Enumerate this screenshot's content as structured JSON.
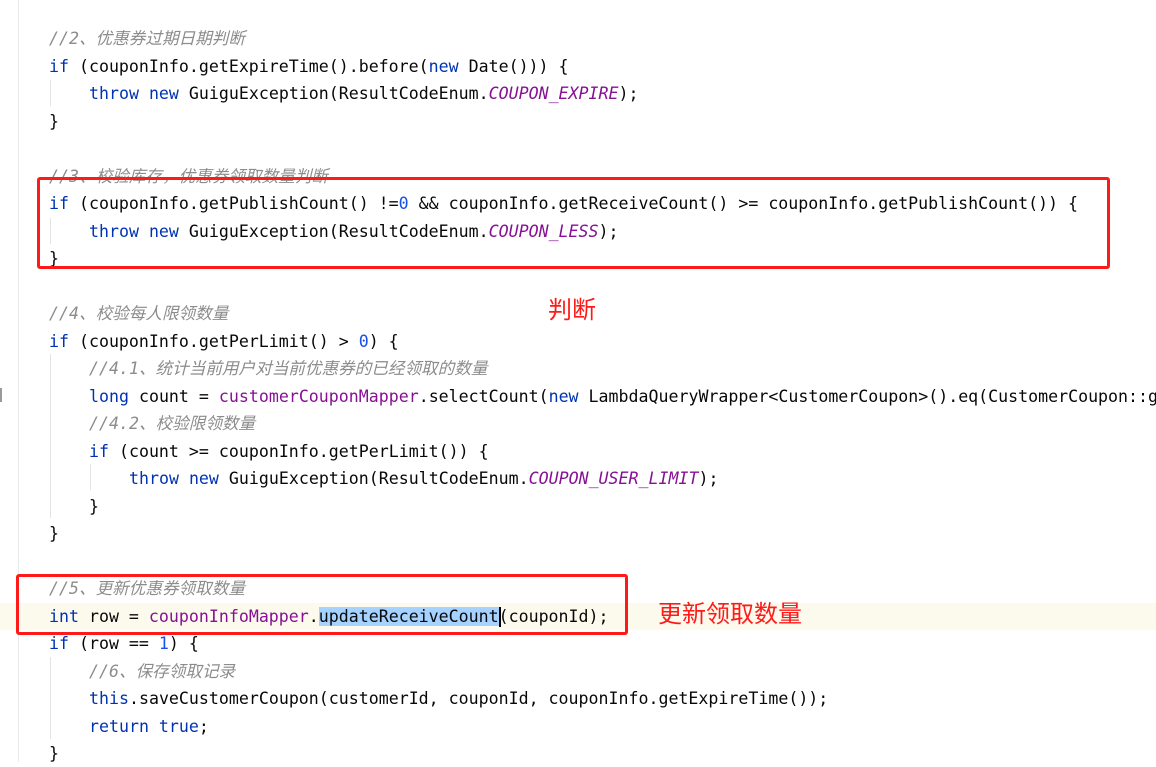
{
  "editor": {
    "caret_line": 21,
    "colors": {
      "keyword": "#0033b3",
      "field": "#871094",
      "comment": "#8c8c8c",
      "number": "#1750eb",
      "text": "#080808",
      "selection": "#a6d2ff",
      "annotation": "#ff1a1a"
    },
    "lines": [
      {
        "indent": 0,
        "tokens": [
          {
            "t": "c",
            "s": "//2、优惠券过期日期判断"
          }
        ]
      },
      {
        "indent": 0,
        "tokens": [
          {
            "t": "k",
            "s": "if"
          },
          {
            "t": "p",
            "s": " (couponInfo.getExpireTime().before("
          },
          {
            "t": "k",
            "s": "new"
          },
          {
            "t": "p",
            "s": " Date())) {"
          }
        ]
      },
      {
        "indent": 1,
        "tokens": [
          {
            "t": "k",
            "s": "throw new"
          },
          {
            "t": "p",
            "s": " GuiguException(ResultCodeEnum."
          },
          {
            "t": "fi",
            "s": "COUPON_EXPIRE"
          },
          {
            "t": "p",
            "s": ");"
          }
        ]
      },
      {
        "indent": 0,
        "tokens": [
          {
            "t": "p",
            "s": "}"
          }
        ]
      },
      {
        "indent": 0,
        "tokens": []
      },
      {
        "indent": 0,
        "tokens": [
          {
            "t": "c",
            "s": "//3、校验库存，优惠券领取数量判断"
          }
        ]
      },
      {
        "indent": 0,
        "tokens": [
          {
            "t": "k",
            "s": "if"
          },
          {
            "t": "p",
            "s": " (couponInfo.getPublishCount() !="
          },
          {
            "t": "n",
            "s": "0"
          },
          {
            "t": "p",
            "s": " && couponInfo.getReceiveCount() >= couponInfo.getPublishCount()) {"
          }
        ]
      },
      {
        "indent": 1,
        "tokens": [
          {
            "t": "k",
            "s": "throw new"
          },
          {
            "t": "p",
            "s": " GuiguException(ResultCodeEnum."
          },
          {
            "t": "fi",
            "s": "COUPON_LESS"
          },
          {
            "t": "p",
            "s": ");"
          }
        ]
      },
      {
        "indent": 0,
        "tokens": [
          {
            "t": "p",
            "s": "}"
          }
        ]
      },
      {
        "indent": 0,
        "tokens": []
      },
      {
        "indent": 0,
        "tokens": [
          {
            "t": "c",
            "s": "//4、校验每人限领数量"
          }
        ]
      },
      {
        "indent": 0,
        "tokens": [
          {
            "t": "k",
            "s": "if"
          },
          {
            "t": "p",
            "s": " (couponInfo.getPerLimit() > "
          },
          {
            "t": "n",
            "s": "0"
          },
          {
            "t": "p",
            "s": ") {"
          }
        ]
      },
      {
        "indent": 1,
        "tokens": [
          {
            "t": "c",
            "s": "//4.1、统计当前用户对当前优惠券的已经领取的数量"
          }
        ]
      },
      {
        "indent": 1,
        "tokens": [
          {
            "t": "k",
            "s": "long"
          },
          {
            "t": "p",
            "s": " count = "
          },
          {
            "t": "f",
            "s": "customerCouponMapper"
          },
          {
            "t": "p",
            "s": ".selectCount("
          },
          {
            "t": "k",
            "s": "new"
          },
          {
            "t": "p",
            "s": " LambdaQueryWrapper<CustomerCoupon>().eq(CustomerCoupon::g"
          }
        ]
      },
      {
        "indent": 1,
        "tokens": [
          {
            "t": "c",
            "s": "//4.2、校验限领数量"
          }
        ]
      },
      {
        "indent": 1,
        "tokens": [
          {
            "t": "k",
            "s": "if"
          },
          {
            "t": "p",
            "s": " (count >= couponInfo.getPerLimit()) {"
          }
        ]
      },
      {
        "indent": 2,
        "tokens": [
          {
            "t": "k",
            "s": "throw new"
          },
          {
            "t": "p",
            "s": " GuiguException(ResultCodeEnum."
          },
          {
            "t": "fi",
            "s": "COUPON_USER_LIMIT"
          },
          {
            "t": "p",
            "s": ");"
          }
        ]
      },
      {
        "indent": 1,
        "tokens": [
          {
            "t": "p",
            "s": "}"
          }
        ]
      },
      {
        "indent": 0,
        "tokens": [
          {
            "t": "p",
            "s": "}"
          }
        ]
      },
      {
        "indent": 0,
        "tokens": []
      },
      {
        "indent": 0,
        "tokens": [
          {
            "t": "c",
            "s": "//5、更新优惠券领取数量"
          }
        ]
      },
      {
        "indent": 0,
        "tokens": [
          {
            "t": "k",
            "s": "int"
          },
          {
            "t": "p",
            "s": " row = "
          },
          {
            "t": "f",
            "s": "couponInfoMapper"
          },
          {
            "t": "p",
            "s": "."
          },
          {
            "t": "sel",
            "s": "updateReceiveCount"
          },
          {
            "t": "caret",
            "s": ""
          },
          {
            "t": "p",
            "s": "(couponId);"
          }
        ]
      },
      {
        "indent": 0,
        "tokens": [
          {
            "t": "k",
            "s": "if"
          },
          {
            "t": "p",
            "s": " (row == "
          },
          {
            "t": "n",
            "s": "1"
          },
          {
            "t": "p",
            "s": ") {"
          }
        ]
      },
      {
        "indent": 1,
        "tokens": [
          {
            "t": "c",
            "s": "//6、保存领取记录"
          }
        ]
      },
      {
        "indent": 1,
        "tokens": [
          {
            "t": "k",
            "s": "this"
          },
          {
            "t": "p",
            "s": ".saveCustomerCoupon(customerId, couponId, couponInfo.getExpireTime());"
          }
        ]
      },
      {
        "indent": 1,
        "tokens": [
          {
            "t": "k",
            "s": "return true"
          },
          {
            "t": "p",
            "s": ";"
          }
        ]
      },
      {
        "indent": 0,
        "tokens": [
          {
            "t": "p",
            "s": "}"
          }
        ]
      }
    ]
  },
  "annotations": {
    "note_judge": "判断",
    "note_update": "更新领取数量"
  }
}
